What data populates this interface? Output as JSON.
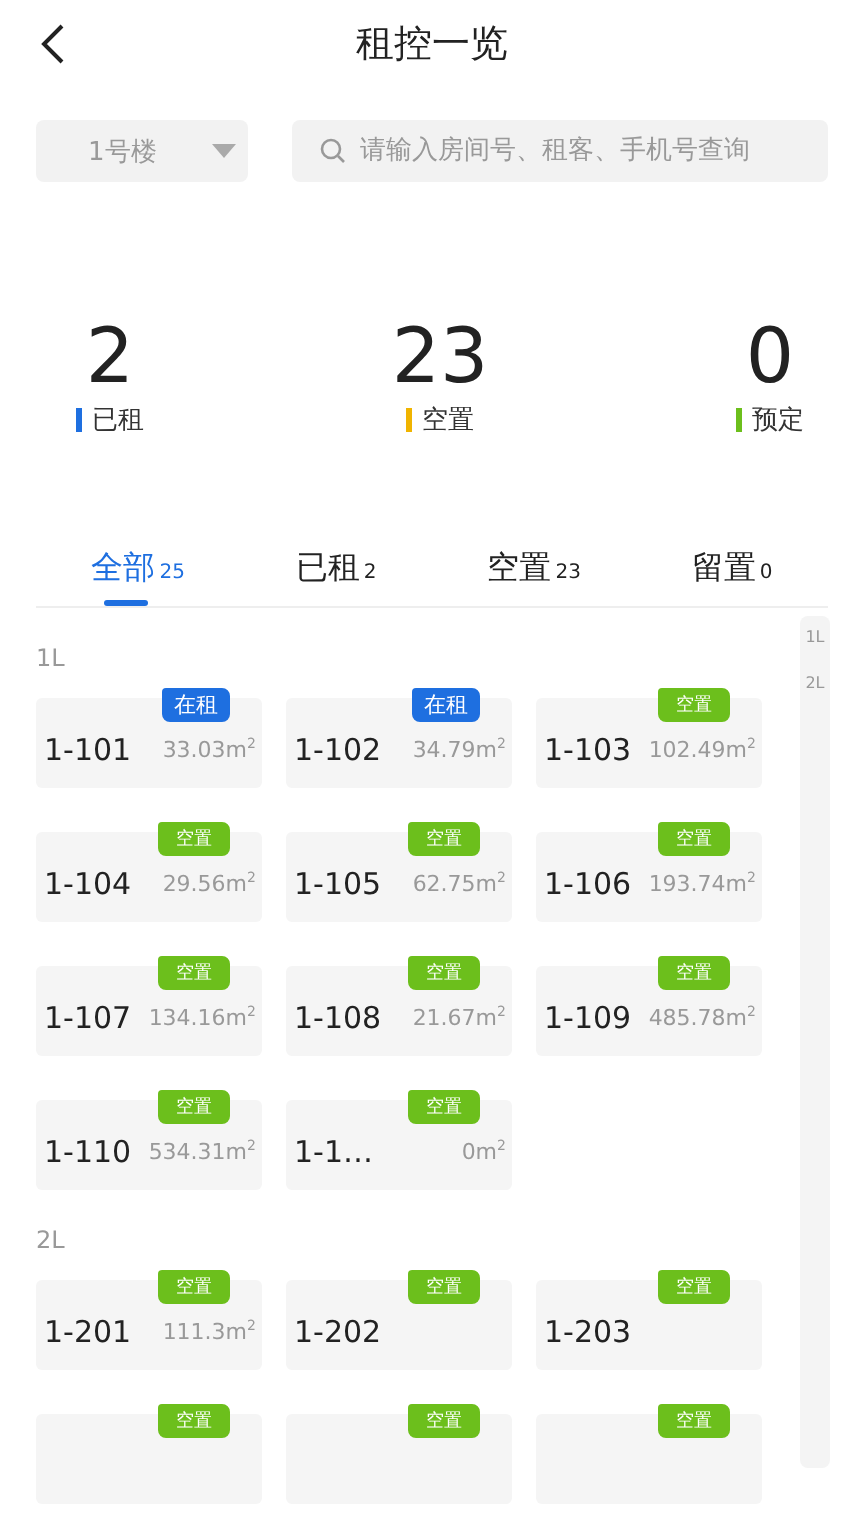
{
  "header": {
    "title": "租控一览"
  },
  "filters": {
    "building": "1号楼",
    "search_placeholder": "请输入房间号、租客、手机号查询"
  },
  "stats": [
    {
      "value": "2",
      "label": "已租",
      "color": "#1e6fe0"
    },
    {
      "value": "23",
      "label": "空置",
      "color": "#f0b400"
    },
    {
      "value": "0",
      "label": "预定",
      "color": "#6cbf1c"
    }
  ],
  "tabs": [
    {
      "label": "全部",
      "count": "25",
      "selected": true
    },
    {
      "label": "已租",
      "count": "2",
      "selected": false
    },
    {
      "label": "空置",
      "count": "23",
      "selected": false
    },
    {
      "label": "留置",
      "count": "0",
      "selected": false
    }
  ],
  "index": [
    "1L",
    "2L"
  ],
  "floors": [
    {
      "label": "1L",
      "rooms": [
        {
          "name": "1-101",
          "area": "33.03m$^{2}$",
          "tag": "在租",
          "kind": "rented"
        },
        {
          "name": "1-102",
          "area": "34.79m$^{2}$",
          "tag": "在租",
          "kind": "rented"
        },
        {
          "name": "1-103",
          "area": "102.49m$^{2}$",
          "tag": "空置",
          "kind": "vacant"
        },
        {
          "name": "1-104",
          "area": "29.56m$^{2}$",
          "tag": "空置",
          "kind": "vacant"
        },
        {
          "name": "1-105",
          "area": "62.75m$^{2}$",
          "tag": "空置",
          "kind": "vacant"
        },
        {
          "name": "1-106",
          "area": "193.74m$^{2}$",
          "tag": "空置",
          "kind": "vacant"
        },
        {
          "name": "1-107",
          "area": "134.16m$^{2}$",
          "tag": "空置",
          "kind": "vacant"
        },
        {
          "name": "1-108",
          "area": "21.67m$^{2}$",
          "tag": "空置",
          "kind": "vacant"
        },
        {
          "name": "1-109",
          "area": "485.78m$^{2}$",
          "tag": "空置",
          "kind": "vacant"
        },
        {
          "name": "1-110",
          "area": "534.31m$^{2}$",
          "tag": "空置",
          "kind": "vacant"
        },
        {
          "name": "1-1…",
          "area": "0m$^{2}$",
          "tag": "空置",
          "kind": "vacant"
        }
      ]
    },
    {
      "label": "2L",
      "rooms": [
        {
          "name": "1-201",
          "area": "111.3m$^{2}$",
          "tag": "空置",
          "kind": "vacant"
        },
        {
          "name": "1-202",
          "tag": "空置",
          "kind": "vacant"
        },
        {
          "name": "1-203",
          "tag": "空置",
          "kind": "vacant"
        },
        {
          "tag": "空置",
          "kind": "vacant"
        },
        {
          "tag": "空置",
          "kind": "vacant"
        },
        {
          "tag": "空置",
          "kind": "vacant"
        }
      ]
    }
  ]
}
